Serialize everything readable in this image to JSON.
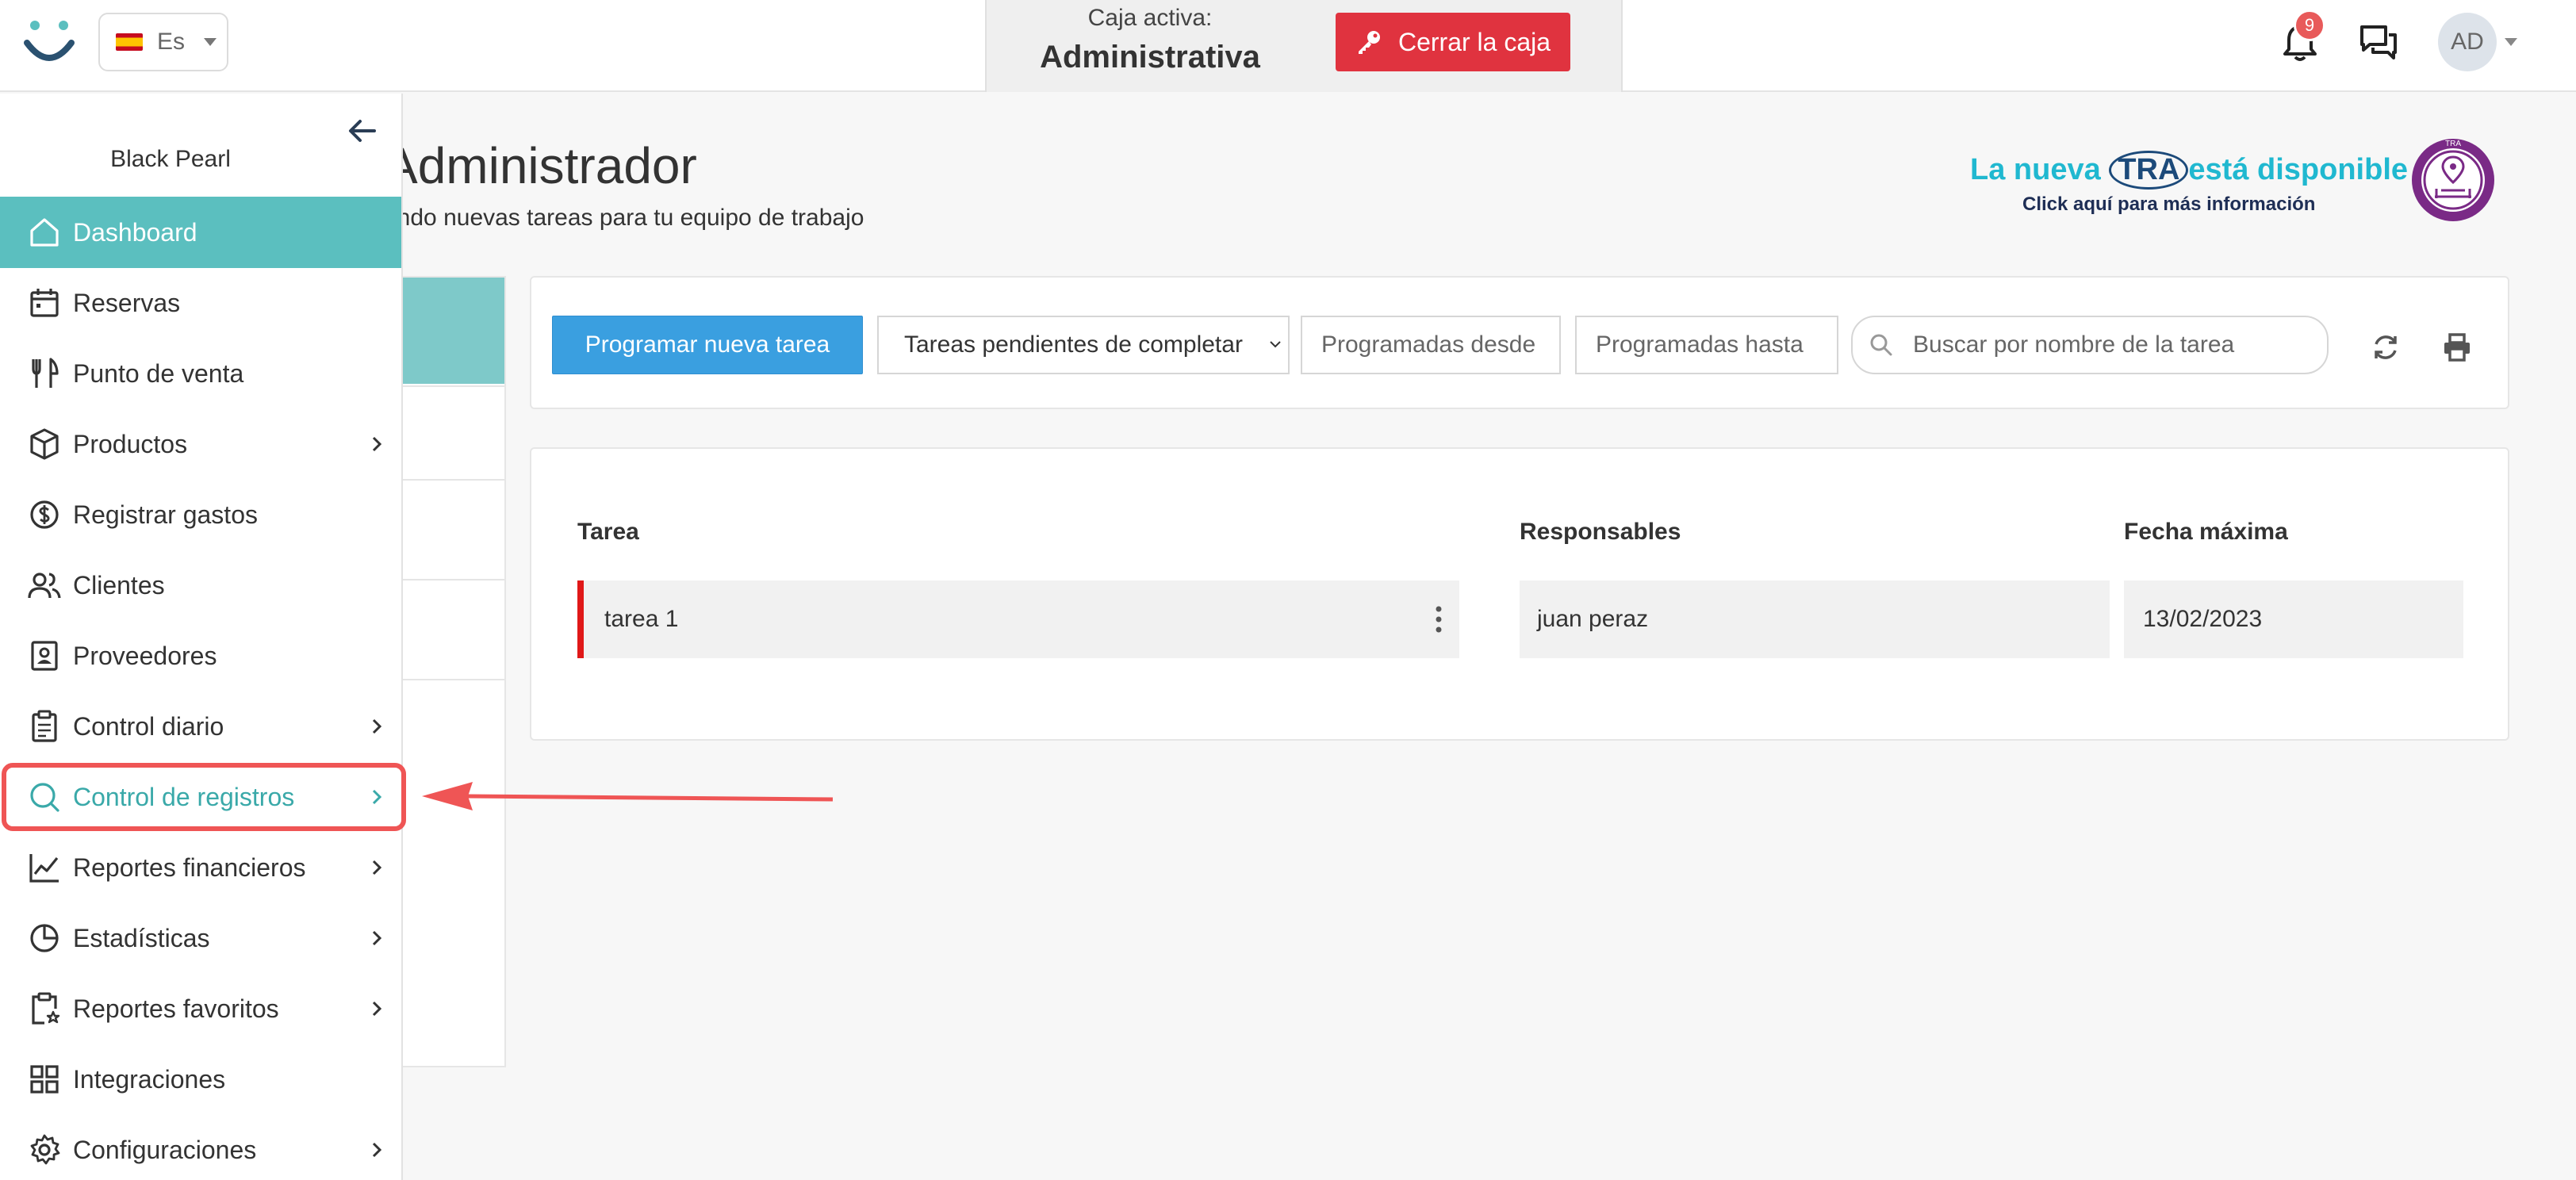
{
  "header": {
    "language": "Es",
    "cashbox_label": "Caja activa:",
    "cashbox_value": "Administrativa",
    "close_cashbox_button": "Cerrar la caja",
    "notifications_count": "9",
    "user_initials": "AD"
  },
  "page": {
    "title": "Administrador",
    "subtitle": "ando nuevas tareas para tu equipo de trabajo"
  },
  "promo": {
    "prefix": "La nueva ",
    "highlight": "TRA",
    "suffix": "está disponible",
    "cta": "Click aquí para más información",
    "seal_text": "TRA"
  },
  "toolbar": {
    "new_task_button": "Programar nueva tarea",
    "status_filter": "Tareas pendientes de completar",
    "date_from_placeholder": "Programadas desde",
    "date_to_placeholder": "Programadas hasta",
    "search_placeholder": "Buscar por nombre de la tarea"
  },
  "table": {
    "headers": [
      "Tarea",
      "Responsables",
      "Fecha máxima"
    ],
    "rows": [
      {
        "task": "tarea 1",
        "responsible": "juan peraz",
        "due_date": "13/02/2023"
      }
    ]
  },
  "sidebar": {
    "company": "Black Pearl",
    "items": [
      {
        "label": "Dashboard",
        "icon": "home-icon",
        "state": "active"
      },
      {
        "label": "Reservas",
        "icon": "calendar-icon"
      },
      {
        "label": "Punto de venta",
        "icon": "fork-knife-icon"
      },
      {
        "label": "Productos",
        "icon": "box-icon",
        "has_submenu": true
      },
      {
        "label": "Registrar gastos",
        "icon": "dollar-circle-icon"
      },
      {
        "label": "Clientes",
        "icon": "users-icon"
      },
      {
        "label": "Proveedores",
        "icon": "contact-book-icon"
      },
      {
        "label": "Control diario",
        "icon": "clipboard-icon",
        "has_submenu": true
      },
      {
        "label": "Control de registros",
        "icon": "search-icon",
        "has_submenu": true,
        "state": "highlighted"
      },
      {
        "label": "Reportes financieros",
        "icon": "line-chart-icon",
        "has_submenu": true
      },
      {
        "label": "Estadísticas",
        "icon": "pie-chart-icon",
        "has_submenu": true
      },
      {
        "label": "Reportes favoritos",
        "icon": "clipboard-star-icon",
        "has_submenu": true
      },
      {
        "label": "Integraciones",
        "icon": "grid-icon"
      },
      {
        "label": "Configuraciones",
        "icon": "gear-icon",
        "has_submenu": true
      }
    ]
  },
  "colors": {
    "accent_teal": "#5bbfbf",
    "primary_blue": "#3a9fe0",
    "danger_red": "#e0333f",
    "annotation_red": "#ef5555"
  }
}
